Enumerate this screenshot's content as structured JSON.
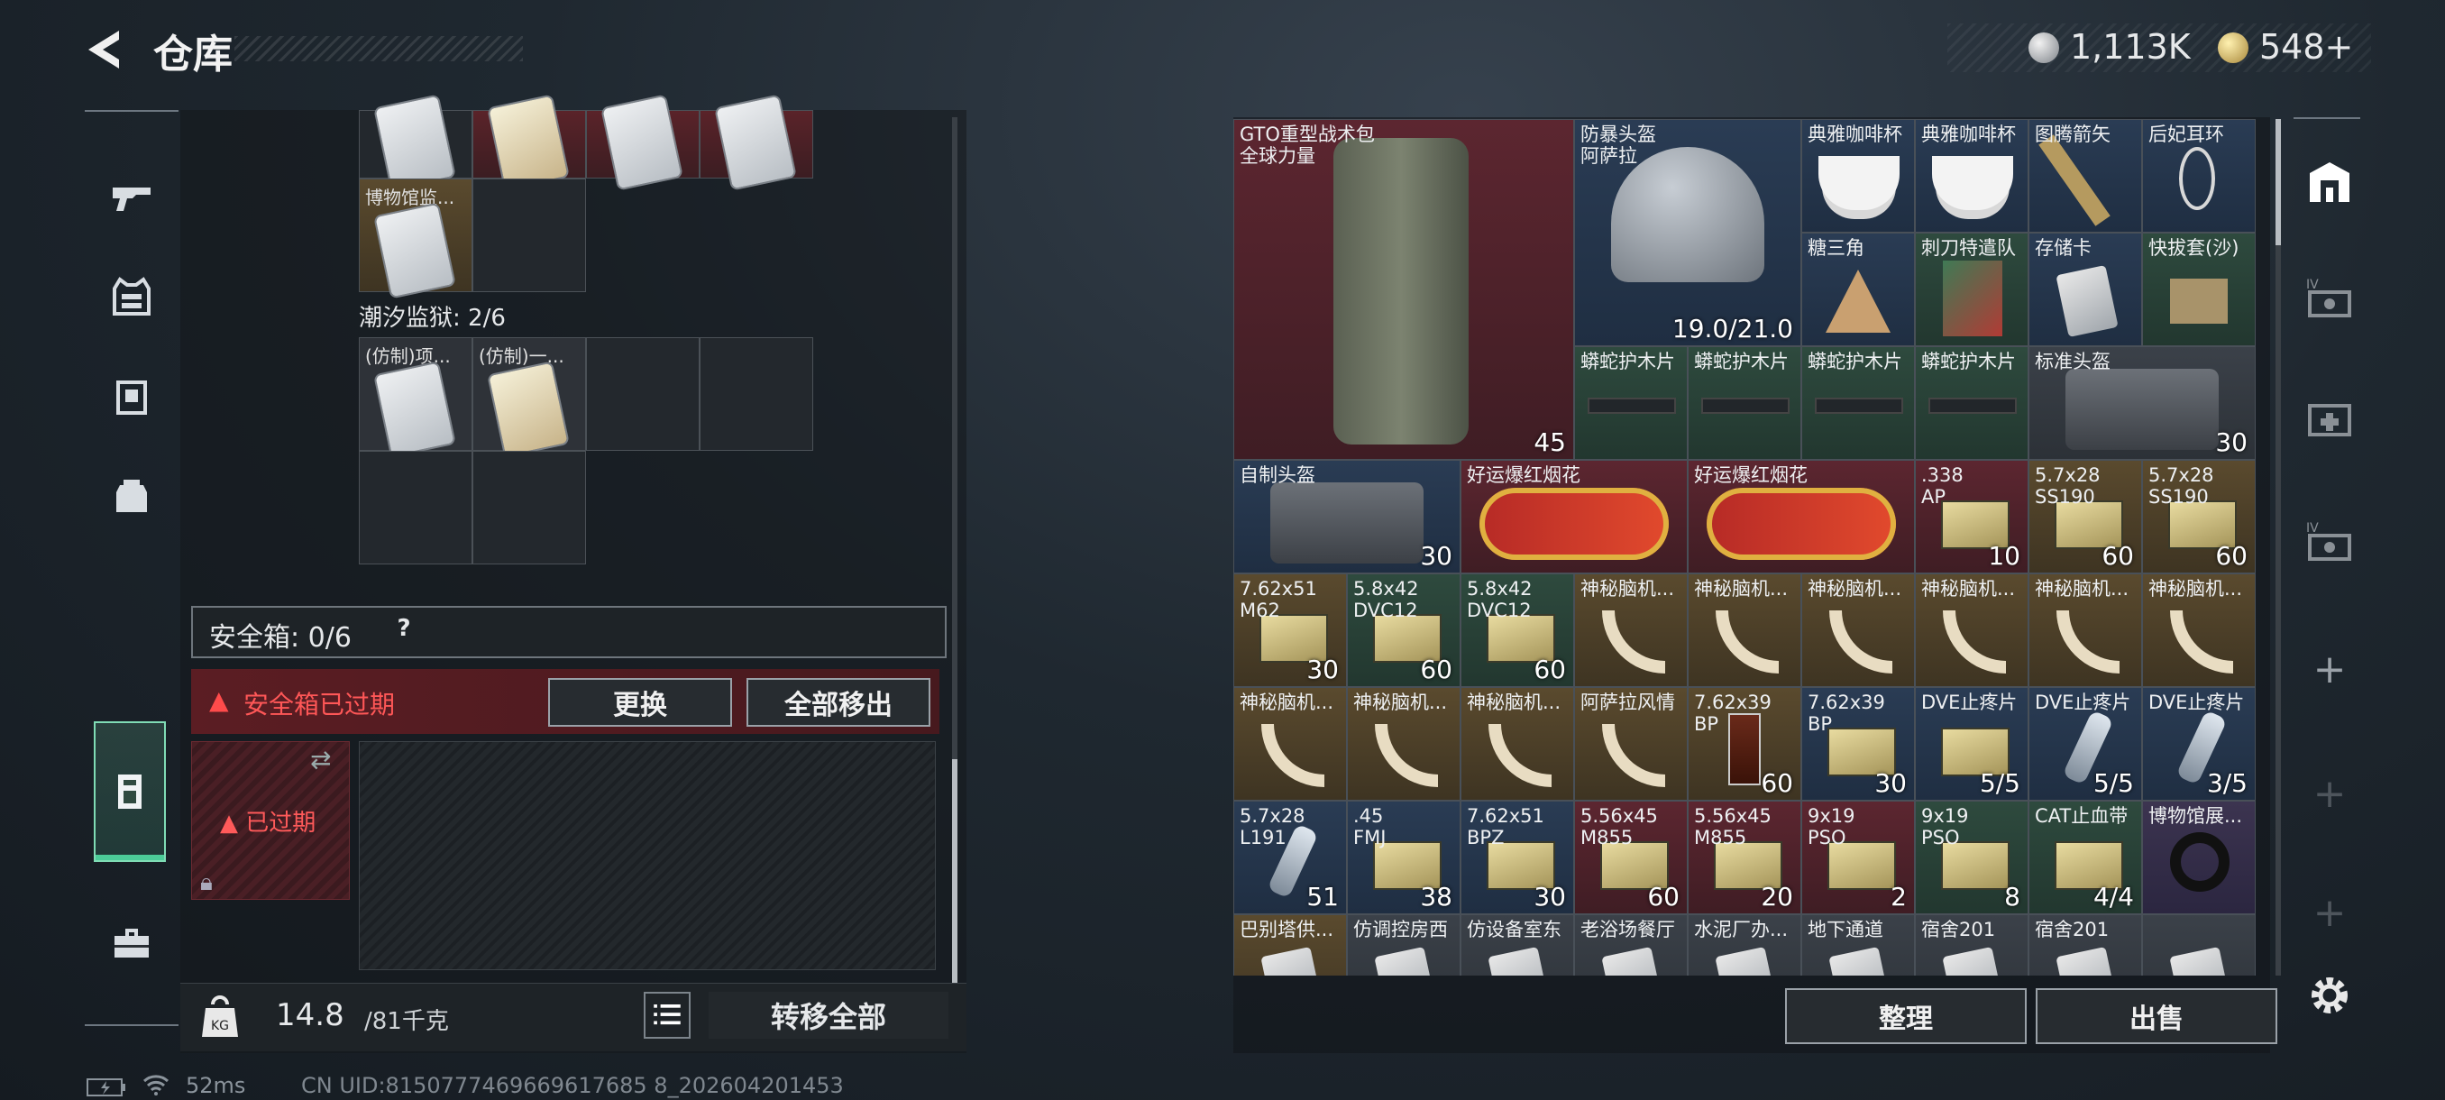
{
  "header": {
    "title": "仓库",
    "silver": "1,113K",
    "gold": "548+"
  },
  "left_panel": {
    "row1_items": [
      "",
      "",
      "",
      ""
    ],
    "museum_item": "博物馆监...",
    "tide_prison": "潮汐监狱: 2/6",
    "fake_items": [
      "(仿制)项...",
      "(仿制)一..."
    ],
    "safebox_label": "安全箱: 0/6",
    "safebox_help": "?",
    "expired_warning": "安全箱已过期",
    "replace_button": "更换",
    "move_all_button": "全部移出",
    "slot_expired": "已过期",
    "weight_current": "14.8",
    "weight_total": "/81千克",
    "transfer_all_button": "转移全部"
  },
  "stash": {
    "items": [
      {
        "name": "GTO重型战术包\n全球力量",
        "count": "45"
      },
      {
        "name": "防暴头盔\n阿萨拉",
        "count": "19.0/21.0"
      },
      {
        "name": "典雅咖啡杯",
        "count": ""
      },
      {
        "name": "典雅咖啡杯",
        "count": ""
      },
      {
        "name": "图腾箭矢",
        "count": ""
      },
      {
        "name": "后妃耳环",
        "count": ""
      },
      {
        "name": "糖三角",
        "count": ""
      },
      {
        "name": "刺刀特遣队",
        "count": ""
      },
      {
        "name": "存储卡",
        "count": ""
      },
      {
        "name": "快拔套(沙)",
        "count": ""
      },
      {
        "name": "蟒蛇护木片",
        "count": ""
      },
      {
        "name": "蟒蛇护木片",
        "count": ""
      },
      {
        "name": "蟒蛇护木片",
        "count": ""
      },
      {
        "name": "蟒蛇护木片",
        "count": ""
      },
      {
        "name": "标准头盔",
        "count": "30"
      },
      {
        "name": "自制头盔",
        "count": "30"
      },
      {
        "name": "好运爆红烟花",
        "count": ""
      },
      {
        "name": "好运爆红烟花",
        "count": ""
      },
      {
        "name": ".338\nAP",
        "count": "10"
      },
      {
        "name": "5.7x28\nSS190",
        "count": "60"
      },
      {
        "name": "5.7x28\nSS190",
        "count": "60"
      },
      {
        "name": "7.62x51\nM62",
        "count": "30"
      },
      {
        "name": "5.8x42\nDVC12",
        "count": "60"
      },
      {
        "name": "5.8x42\nDVC12",
        "count": "60"
      },
      {
        "name": "神秘脑机...",
        "count": ""
      },
      {
        "name": "神秘脑机...",
        "count": ""
      },
      {
        "name": "神秘脑机...",
        "count": ""
      },
      {
        "name": "神秘脑机...",
        "count": ""
      },
      {
        "name": "神秘脑机...",
        "count": ""
      },
      {
        "name": "神秘脑机...",
        "count": ""
      },
      {
        "name": "神秘脑机...",
        "count": ""
      },
      {
        "name": "神秘脑机...",
        "count": ""
      },
      {
        "name": "神秘脑机...",
        "count": ""
      },
      {
        "name": "阿萨拉风情",
        "count": ""
      },
      {
        "name": "7.62x39\nBP",
        "count": "60"
      },
      {
        "name": "7.62x39\nBP",
        "count": "30"
      },
      {
        "name": "DVE止疼片",
        "count": "5/5"
      },
      {
        "name": "DVE止疼片",
        "count": "5/5"
      },
      {
        "name": "DVE止疼片",
        "count": "3/5"
      },
      {
        "name": "5.7x28\nL191",
        "count": "51"
      },
      {
        "name": ".45\nFMJ",
        "count": "38"
      },
      {
        "name": "7.62x51\nBPZ",
        "count": "30"
      },
      {
        "name": "5.56x45\nM855",
        "count": "60"
      },
      {
        "name": "5.56x45\nM855",
        "count": "20"
      },
      {
        "name": "9x19\nPSO",
        "count": "2"
      },
      {
        "name": "9x19\nPSO",
        "count": "8"
      },
      {
        "name": "CAT止血带",
        "count": "4/4"
      },
      {
        "name": "博物馆展...",
        "count": ""
      },
      {
        "name": "巴别塔供...",
        "count": ""
      },
      {
        "name": "仿调控房西",
        "count": ""
      },
      {
        "name": "仿设备室东",
        "count": ""
      },
      {
        "name": "老浴场餐厅",
        "count": ""
      },
      {
        "name": "水泥厂办...",
        "count": ""
      },
      {
        "name": "地下通道",
        "count": ""
      },
      {
        "name": "宿舍201",
        "count": ""
      },
      {
        "name": "宿舍201",
        "count": ""
      }
    ],
    "arrange_button": "整理",
    "sell_button": "出售"
  },
  "footer": {
    "ping": "52ms",
    "uid": "CN UID:8150777469669617685 8_202604201453"
  }
}
